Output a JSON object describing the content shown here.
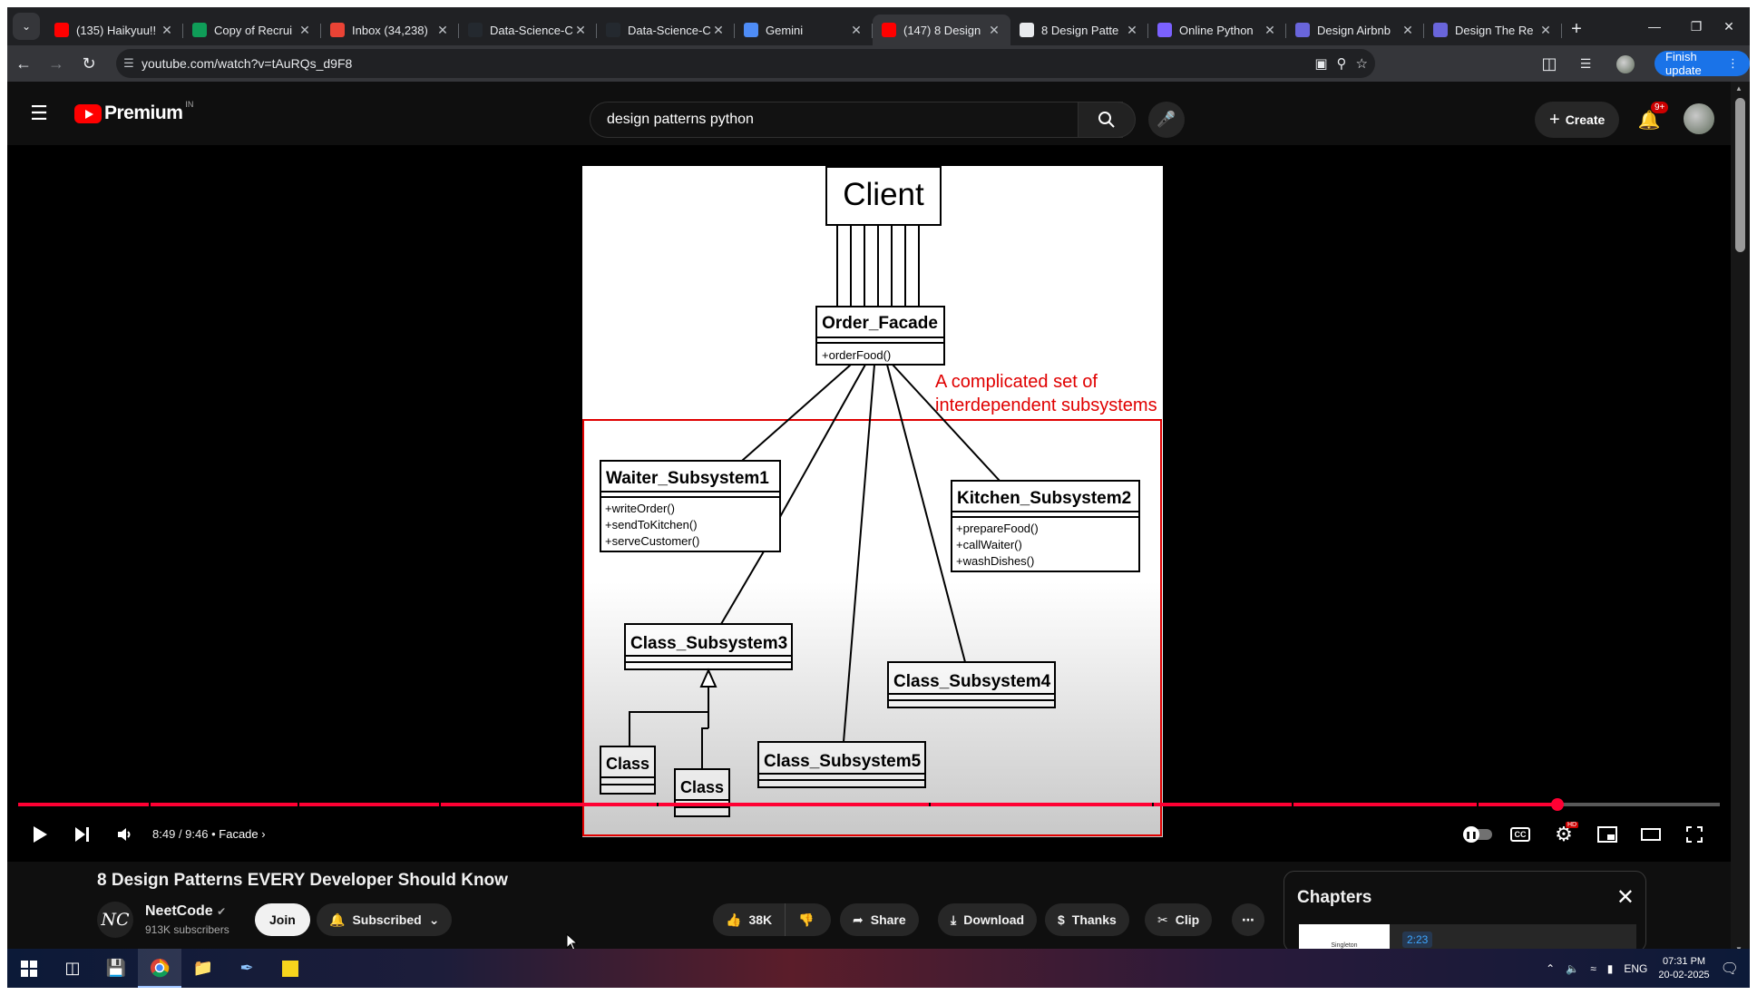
{
  "browser": {
    "tabs": [
      {
        "title": "(135) Haikyuu!!",
        "favicon": "youtube-icon",
        "color": "#ff0000",
        "active": false
      },
      {
        "title": "Copy of Recrui",
        "favicon": "sheets-icon",
        "color": "#0f9d58",
        "active": false
      },
      {
        "title": "Inbox (34,238)",
        "favicon": "gmail-icon",
        "color": "#ea4335",
        "active": false
      },
      {
        "title": "Data-Science-C",
        "favicon": "github-icon",
        "color": "#24292f",
        "active": false
      },
      {
        "title": "Data-Science-C",
        "favicon": "github-icon",
        "color": "#24292f",
        "active": false
      },
      {
        "title": "Gemini",
        "favicon": "gemini-icon",
        "color": "#4e8cf6",
        "active": false
      },
      {
        "title": "(147) 8 Design",
        "favicon": "youtube-icon",
        "color": "#ff0000",
        "active": true
      },
      {
        "title": "8 Design Patte",
        "favicon": "pin-icon",
        "color": "#e8eaed",
        "active": false
      },
      {
        "title": "Online Python",
        "favicon": "python-icon",
        "color": "#7b61ff",
        "active": false
      },
      {
        "title": "Design Airbnb",
        "favicon": "excalidraw-icon",
        "color": "#6965db",
        "active": false
      },
      {
        "title": "Design The Re",
        "favicon": "excalidraw-icon",
        "color": "#6965db",
        "active": false
      }
    ],
    "url": "youtube.com/watch?v=tAuRQs_d9F8",
    "finish_update_label": "Finish update"
  },
  "masthead": {
    "logo_text": "Premium",
    "country": "IN",
    "search_value": "design patterns python",
    "create_label": "Create",
    "notifications_badge": "9+"
  },
  "slide": {
    "client_label": "Client",
    "facade": {
      "name": "Order_Facade",
      "methods": [
        "+orderFood()"
      ]
    },
    "annotation_line1": "A complicated set of",
    "annotation_line2": "interdependent subsystems",
    "waiter": {
      "name": "Waiter_Subsystem1",
      "methods": [
        "+writeOrder()",
        "+sendToKitchen()",
        "+serveCustomer()"
      ]
    },
    "kitchen": {
      "name": "Kitchen_Subsystem2",
      "methods": [
        "+prepareFood()",
        "+callWaiter()",
        "+washDishes()"
      ]
    },
    "class3": {
      "name": "Class_Subsystem3"
    },
    "class4": {
      "name": "Class_Subsystem4"
    },
    "class5": {
      "name": "Class_Subsystem5"
    },
    "subclass_a": {
      "name": "Class"
    },
    "subclass_b": {
      "name": "Class"
    },
    "annotation_color": "#e00000"
  },
  "player": {
    "current_time": "8:49",
    "duration": "9:46",
    "chapter": "Facade",
    "progress_fraction": 0.9044,
    "quality_badge": "HD",
    "accent_color": "#ff0033"
  },
  "video": {
    "title": "8 Design Patterns EVERY Developer Should Know",
    "channel_name": "NeetCode",
    "channel_avatar_text": "NC",
    "subscribers": "913K subscribers",
    "join_label": "Join",
    "subscribed_label": "Subscribed",
    "likes": "38K",
    "share_label": "Share",
    "download_label": "Download",
    "thanks_label": "Thanks",
    "clip_label": "Clip"
  },
  "chapters": {
    "heading": "Chapters",
    "first_thumb_label": "Singleton",
    "first_timestamp": "2:23"
  },
  "taskbar": {
    "language": "ENG",
    "time": "07:31 PM",
    "date": "20-02-2025"
  }
}
